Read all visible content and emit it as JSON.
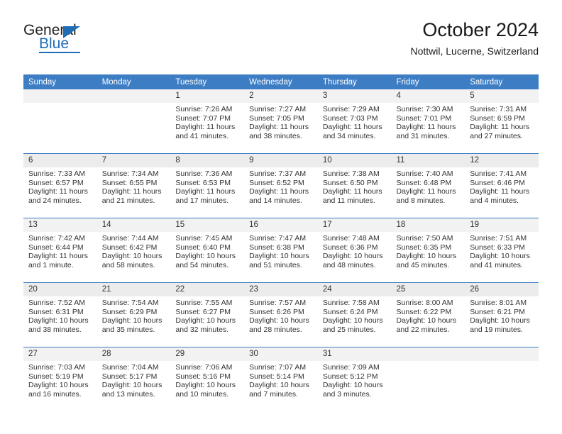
{
  "brand": {
    "name_top": "General",
    "name_bottom": "Blue",
    "accent_color": "#1f6db5"
  },
  "header": {
    "title": "October 2024",
    "location": "Nottwil, Lucerne, Switzerland"
  },
  "calendar": {
    "header_color": "#3c7dc4",
    "weekdays": [
      "Sunday",
      "Monday",
      "Tuesday",
      "Wednesday",
      "Thursday",
      "Friday",
      "Saturday"
    ],
    "weeks": [
      [
        {
          "day": "",
          "details": ""
        },
        {
          "day": "",
          "details": ""
        },
        {
          "day": "1",
          "details": "Sunrise: 7:26 AM\nSunset: 7:07 PM\nDaylight: 11 hours\nand 41 minutes."
        },
        {
          "day": "2",
          "details": "Sunrise: 7:27 AM\nSunset: 7:05 PM\nDaylight: 11 hours\nand 38 minutes."
        },
        {
          "day": "3",
          "details": "Sunrise: 7:29 AM\nSunset: 7:03 PM\nDaylight: 11 hours\nand 34 minutes."
        },
        {
          "day": "4",
          "details": "Sunrise: 7:30 AM\nSunset: 7:01 PM\nDaylight: 11 hours\nand 31 minutes."
        },
        {
          "day": "5",
          "details": "Sunrise: 7:31 AM\nSunset: 6:59 PM\nDaylight: 11 hours\nand 27 minutes."
        }
      ],
      [
        {
          "day": "6",
          "details": "Sunrise: 7:33 AM\nSunset: 6:57 PM\nDaylight: 11 hours\nand 24 minutes."
        },
        {
          "day": "7",
          "details": "Sunrise: 7:34 AM\nSunset: 6:55 PM\nDaylight: 11 hours\nand 21 minutes."
        },
        {
          "day": "8",
          "details": "Sunrise: 7:36 AM\nSunset: 6:53 PM\nDaylight: 11 hours\nand 17 minutes."
        },
        {
          "day": "9",
          "details": "Sunrise: 7:37 AM\nSunset: 6:52 PM\nDaylight: 11 hours\nand 14 minutes."
        },
        {
          "day": "10",
          "details": "Sunrise: 7:38 AM\nSunset: 6:50 PM\nDaylight: 11 hours\nand 11 minutes."
        },
        {
          "day": "11",
          "details": "Sunrise: 7:40 AM\nSunset: 6:48 PM\nDaylight: 11 hours\nand 8 minutes."
        },
        {
          "day": "12",
          "details": "Sunrise: 7:41 AM\nSunset: 6:46 PM\nDaylight: 11 hours\nand 4 minutes."
        }
      ],
      [
        {
          "day": "13",
          "details": "Sunrise: 7:42 AM\nSunset: 6:44 PM\nDaylight: 11 hours\nand 1 minute."
        },
        {
          "day": "14",
          "details": "Sunrise: 7:44 AM\nSunset: 6:42 PM\nDaylight: 10 hours\nand 58 minutes."
        },
        {
          "day": "15",
          "details": "Sunrise: 7:45 AM\nSunset: 6:40 PM\nDaylight: 10 hours\nand 54 minutes."
        },
        {
          "day": "16",
          "details": "Sunrise: 7:47 AM\nSunset: 6:38 PM\nDaylight: 10 hours\nand 51 minutes."
        },
        {
          "day": "17",
          "details": "Sunrise: 7:48 AM\nSunset: 6:36 PM\nDaylight: 10 hours\nand 48 minutes."
        },
        {
          "day": "18",
          "details": "Sunrise: 7:50 AM\nSunset: 6:35 PM\nDaylight: 10 hours\nand 45 minutes."
        },
        {
          "day": "19",
          "details": "Sunrise: 7:51 AM\nSunset: 6:33 PM\nDaylight: 10 hours\nand 41 minutes."
        }
      ],
      [
        {
          "day": "20",
          "details": "Sunrise: 7:52 AM\nSunset: 6:31 PM\nDaylight: 10 hours\nand 38 minutes."
        },
        {
          "day": "21",
          "details": "Sunrise: 7:54 AM\nSunset: 6:29 PM\nDaylight: 10 hours\nand 35 minutes."
        },
        {
          "day": "22",
          "details": "Sunrise: 7:55 AM\nSunset: 6:27 PM\nDaylight: 10 hours\nand 32 minutes."
        },
        {
          "day": "23",
          "details": "Sunrise: 7:57 AM\nSunset: 6:26 PM\nDaylight: 10 hours\nand 28 minutes."
        },
        {
          "day": "24",
          "details": "Sunrise: 7:58 AM\nSunset: 6:24 PM\nDaylight: 10 hours\nand 25 minutes."
        },
        {
          "day": "25",
          "details": "Sunrise: 8:00 AM\nSunset: 6:22 PM\nDaylight: 10 hours\nand 22 minutes."
        },
        {
          "day": "26",
          "details": "Sunrise: 8:01 AM\nSunset: 6:21 PM\nDaylight: 10 hours\nand 19 minutes."
        }
      ],
      [
        {
          "day": "27",
          "details": "Sunrise: 7:03 AM\nSunset: 5:19 PM\nDaylight: 10 hours\nand 16 minutes."
        },
        {
          "day": "28",
          "details": "Sunrise: 7:04 AM\nSunset: 5:17 PM\nDaylight: 10 hours\nand 13 minutes."
        },
        {
          "day": "29",
          "details": "Sunrise: 7:06 AM\nSunset: 5:16 PM\nDaylight: 10 hours\nand 10 minutes."
        },
        {
          "day": "30",
          "details": "Sunrise: 7:07 AM\nSunset: 5:14 PM\nDaylight: 10 hours\nand 7 minutes."
        },
        {
          "day": "31",
          "details": "Sunrise: 7:09 AM\nSunset: 5:12 PM\nDaylight: 10 hours\nand 3 minutes."
        },
        {
          "day": "",
          "details": ""
        },
        {
          "day": "",
          "details": ""
        }
      ]
    ]
  }
}
